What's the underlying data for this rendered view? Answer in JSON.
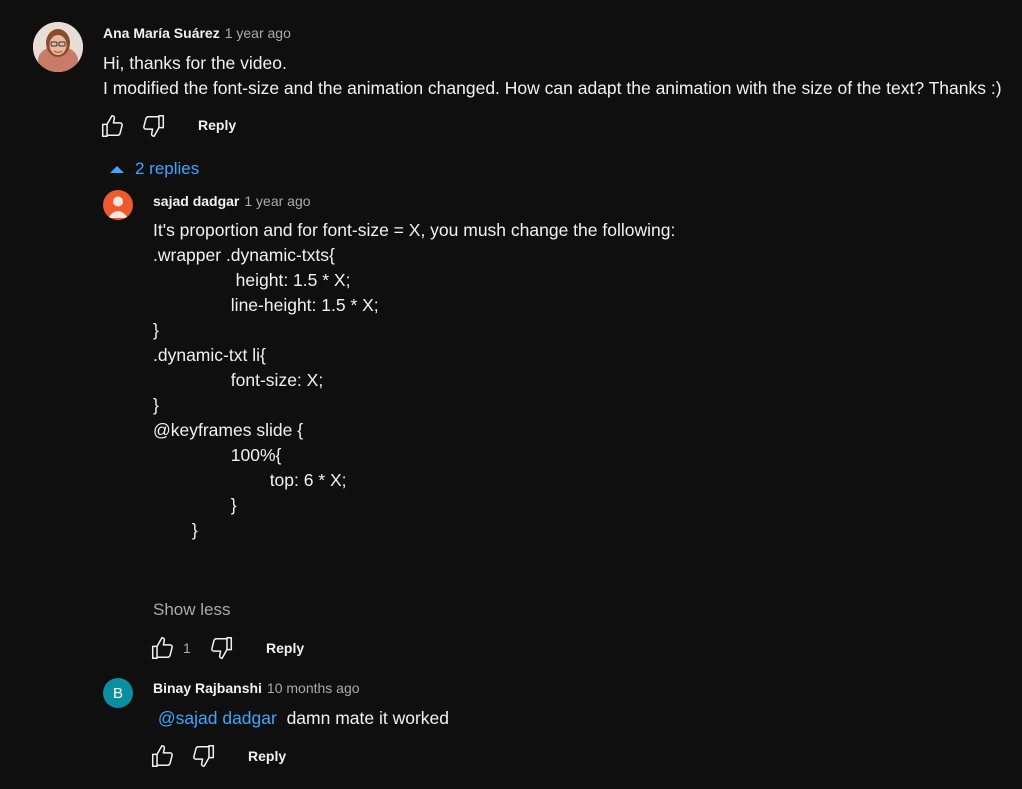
{
  "comment": {
    "author": "Ana María Suárez",
    "time": "1 year ago",
    "lines": [
      "Hi, thanks for the video.",
      "I modified the font-size and the animation changed. How can adapt the animation with the size of the text? Thanks :)"
    ],
    "reply_label": "Reply"
  },
  "replies_toggle": {
    "label": "2 replies"
  },
  "reply1": {
    "author": "sajad dadgar",
    "time": "1 year ago",
    "lines": [
      "It's proportion and for font-size = X, you mush change the following:",
      ".wrapper .dynamic-txts{",
      "                 height: 1.5 * X;",
      "                line-height: 1.5 * X;",
      "}",
      "",
      ".dynamic-txt li{",
      "                font-size: X;",
      "}",
      "",
      "@keyframes slide {",
      "                100%{",
      "                        top: 6 * X;",
      "                }",
      "        }"
    ],
    "show_less": "Show less",
    "like_count": "1",
    "reply_label": "Reply"
  },
  "reply2": {
    "author": "Binay Rajbanshi",
    "time": "10 months ago",
    "avatar_letter": "B",
    "mention": "@sajad dadgar",
    "text": "damn mate it worked",
    "reply_label": "Reply"
  },
  "colors": {
    "background": "#0f0f0f",
    "link_blue": "#3ea6ff",
    "secondary_text": "#aaaaaa",
    "avatar_orange": "#ef5a2d",
    "avatar_teal": "#0a8ea0"
  }
}
